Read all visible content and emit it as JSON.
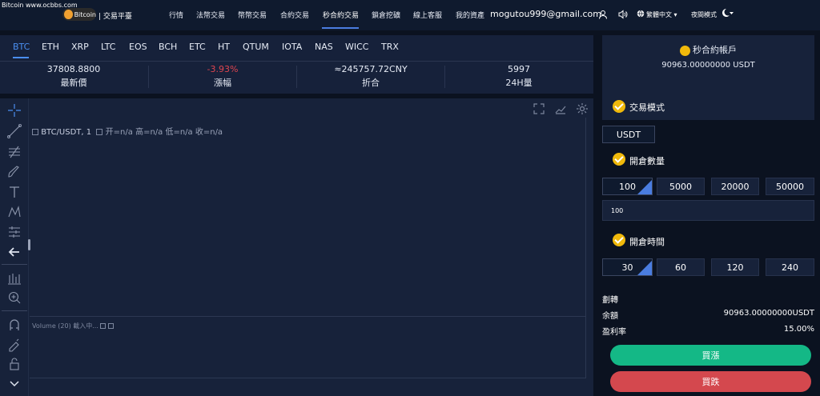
{
  "brand": {
    "url": "Bitcoin www.ocbbs.com",
    "logo": "Bitcoin",
    "subtitle": "| 交易平臺"
  },
  "nav": {
    "items": [
      "行情",
      "法幣交易",
      "幣幣交易",
      "合約交易",
      "秒合約交易",
      "鎖倉挖礦",
      "線上客服",
      "我的資產"
    ],
    "email": "mogutou999@gmail.com",
    "language": "繁體中文",
    "mode": "夜間模式"
  },
  "market": {
    "tabs": [
      "BTC",
      "ETH",
      "XRP",
      "LTC",
      "EOS",
      "BCH",
      "ETC",
      "HT",
      "QTUM",
      "IOTA",
      "NAS",
      "WICC",
      "TRX"
    ],
    "active_tab": "BTC",
    "stats": [
      {
        "value": "37808.8800",
        "label": "最新價"
      },
      {
        "value": "-3.93%",
        "label": "漲幅"
      },
      {
        "value": "≈245757.72CNY",
        "label": "折合"
      },
      {
        "value": "5997",
        "label": "24H量"
      }
    ]
  },
  "chart": {
    "pair": "BTC/USDT, 1",
    "ohlc": "开=n/a  高=n/a  低=n/a  收=n/a",
    "volume": "Volume (20) 載入中..."
  },
  "account": {
    "title": "秒合約帳戶",
    "balance": "90963.00000000 USDT"
  },
  "trade": {
    "mode_title": "交易模式",
    "mode_value": "USDT",
    "qty_title": "開倉數量",
    "qty_options": [
      "100",
      "5000",
      "20000",
      "50000"
    ],
    "qty_input": "100",
    "time_title": "開倉時間",
    "time_options": [
      "30",
      "60",
      "120",
      "240"
    ],
    "fee_label": "劃轉",
    "balance_label": "余額",
    "balance_value": "90963.00000000USDT",
    "profit_label": "盈利率",
    "profit_value": "15.00%",
    "buy_up": "買漲",
    "buy_down": "買跌"
  },
  "colors": {
    "negative": "#e0454f",
    "up": "#14b886",
    "down": "#d4484e",
    "accent": "#4a8ef0",
    "check": "#f0b90b"
  }
}
